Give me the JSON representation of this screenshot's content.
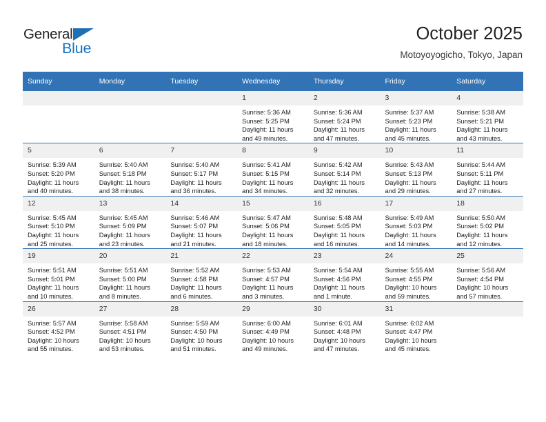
{
  "brand": {
    "name_part1": "General",
    "name_part2": "Blue",
    "accent_color": "#1473c6",
    "triangle_color": "#1f6fb5"
  },
  "header": {
    "title": "October 2025",
    "subtitle": "Motoyoyogicho, Tokyo, Japan"
  },
  "theme": {
    "header_bar": "#3273b5",
    "daynum_bg": "#f0f0f0",
    "week_divider": "#3273b5"
  },
  "weekday_headers": [
    "Sunday",
    "Monday",
    "Tuesday",
    "Wednesday",
    "Thursday",
    "Friday",
    "Saturday"
  ],
  "weeks": [
    [
      {
        "day": "",
        "blank": true,
        "sunrise": "",
        "sunset": "",
        "daylight1": "",
        "daylight2": ""
      },
      {
        "day": "",
        "blank": true,
        "sunrise": "",
        "sunset": "",
        "daylight1": "",
        "daylight2": ""
      },
      {
        "day": "",
        "blank": true,
        "sunrise": "",
        "sunset": "",
        "daylight1": "",
        "daylight2": ""
      },
      {
        "day": "1",
        "sunrise": "Sunrise: 5:36 AM",
        "sunset": "Sunset: 5:25 PM",
        "daylight1": "Daylight: 11 hours",
        "daylight2": "and 49 minutes."
      },
      {
        "day": "2",
        "sunrise": "Sunrise: 5:36 AM",
        "sunset": "Sunset: 5:24 PM",
        "daylight1": "Daylight: 11 hours",
        "daylight2": "and 47 minutes."
      },
      {
        "day": "3",
        "sunrise": "Sunrise: 5:37 AM",
        "sunset": "Sunset: 5:23 PM",
        "daylight1": "Daylight: 11 hours",
        "daylight2": "and 45 minutes."
      },
      {
        "day": "4",
        "sunrise": "Sunrise: 5:38 AM",
        "sunset": "Sunset: 5:21 PM",
        "daylight1": "Daylight: 11 hours",
        "daylight2": "and 43 minutes."
      }
    ],
    [
      {
        "day": "5",
        "sunrise": "Sunrise: 5:39 AM",
        "sunset": "Sunset: 5:20 PM",
        "daylight1": "Daylight: 11 hours",
        "daylight2": "and 40 minutes."
      },
      {
        "day": "6",
        "sunrise": "Sunrise: 5:40 AM",
        "sunset": "Sunset: 5:18 PM",
        "daylight1": "Daylight: 11 hours",
        "daylight2": "and 38 minutes."
      },
      {
        "day": "7",
        "sunrise": "Sunrise: 5:40 AM",
        "sunset": "Sunset: 5:17 PM",
        "daylight1": "Daylight: 11 hours",
        "daylight2": "and 36 minutes."
      },
      {
        "day": "8",
        "sunrise": "Sunrise: 5:41 AM",
        "sunset": "Sunset: 5:15 PM",
        "daylight1": "Daylight: 11 hours",
        "daylight2": "and 34 minutes."
      },
      {
        "day": "9",
        "sunrise": "Sunrise: 5:42 AM",
        "sunset": "Sunset: 5:14 PM",
        "daylight1": "Daylight: 11 hours",
        "daylight2": "and 32 minutes."
      },
      {
        "day": "10",
        "sunrise": "Sunrise: 5:43 AM",
        "sunset": "Sunset: 5:13 PM",
        "daylight1": "Daylight: 11 hours",
        "daylight2": "and 29 minutes."
      },
      {
        "day": "11",
        "sunrise": "Sunrise: 5:44 AM",
        "sunset": "Sunset: 5:11 PM",
        "daylight1": "Daylight: 11 hours",
        "daylight2": "and 27 minutes."
      }
    ],
    [
      {
        "day": "12",
        "sunrise": "Sunrise: 5:45 AM",
        "sunset": "Sunset: 5:10 PM",
        "daylight1": "Daylight: 11 hours",
        "daylight2": "and 25 minutes."
      },
      {
        "day": "13",
        "sunrise": "Sunrise: 5:45 AM",
        "sunset": "Sunset: 5:09 PM",
        "daylight1": "Daylight: 11 hours",
        "daylight2": "and 23 minutes."
      },
      {
        "day": "14",
        "sunrise": "Sunrise: 5:46 AM",
        "sunset": "Sunset: 5:07 PM",
        "daylight1": "Daylight: 11 hours",
        "daylight2": "and 21 minutes."
      },
      {
        "day": "15",
        "sunrise": "Sunrise: 5:47 AM",
        "sunset": "Sunset: 5:06 PM",
        "daylight1": "Daylight: 11 hours",
        "daylight2": "and 18 minutes."
      },
      {
        "day": "16",
        "sunrise": "Sunrise: 5:48 AM",
        "sunset": "Sunset: 5:05 PM",
        "daylight1": "Daylight: 11 hours",
        "daylight2": "and 16 minutes."
      },
      {
        "day": "17",
        "sunrise": "Sunrise: 5:49 AM",
        "sunset": "Sunset: 5:03 PM",
        "daylight1": "Daylight: 11 hours",
        "daylight2": "and 14 minutes."
      },
      {
        "day": "18",
        "sunrise": "Sunrise: 5:50 AM",
        "sunset": "Sunset: 5:02 PM",
        "daylight1": "Daylight: 11 hours",
        "daylight2": "and 12 minutes."
      }
    ],
    [
      {
        "day": "19",
        "sunrise": "Sunrise: 5:51 AM",
        "sunset": "Sunset: 5:01 PM",
        "daylight1": "Daylight: 11 hours",
        "daylight2": "and 10 minutes."
      },
      {
        "day": "20",
        "sunrise": "Sunrise: 5:51 AM",
        "sunset": "Sunset: 5:00 PM",
        "daylight1": "Daylight: 11 hours",
        "daylight2": "and 8 minutes."
      },
      {
        "day": "21",
        "sunrise": "Sunrise: 5:52 AM",
        "sunset": "Sunset: 4:58 PM",
        "daylight1": "Daylight: 11 hours",
        "daylight2": "and 6 minutes."
      },
      {
        "day": "22",
        "sunrise": "Sunrise: 5:53 AM",
        "sunset": "Sunset: 4:57 PM",
        "daylight1": "Daylight: 11 hours",
        "daylight2": "and 3 minutes."
      },
      {
        "day": "23",
        "sunrise": "Sunrise: 5:54 AM",
        "sunset": "Sunset: 4:56 PM",
        "daylight1": "Daylight: 11 hours",
        "daylight2": "and 1 minute."
      },
      {
        "day": "24",
        "sunrise": "Sunrise: 5:55 AM",
        "sunset": "Sunset: 4:55 PM",
        "daylight1": "Daylight: 10 hours",
        "daylight2": "and 59 minutes."
      },
      {
        "day": "25",
        "sunrise": "Sunrise: 5:56 AM",
        "sunset": "Sunset: 4:54 PM",
        "daylight1": "Daylight: 10 hours",
        "daylight2": "and 57 minutes."
      }
    ],
    [
      {
        "day": "26",
        "sunrise": "Sunrise: 5:57 AM",
        "sunset": "Sunset: 4:52 PM",
        "daylight1": "Daylight: 10 hours",
        "daylight2": "and 55 minutes."
      },
      {
        "day": "27",
        "sunrise": "Sunrise: 5:58 AM",
        "sunset": "Sunset: 4:51 PM",
        "daylight1": "Daylight: 10 hours",
        "daylight2": "and 53 minutes."
      },
      {
        "day": "28",
        "sunrise": "Sunrise: 5:59 AM",
        "sunset": "Sunset: 4:50 PM",
        "daylight1": "Daylight: 10 hours",
        "daylight2": "and 51 minutes."
      },
      {
        "day": "29",
        "sunrise": "Sunrise: 6:00 AM",
        "sunset": "Sunset: 4:49 PM",
        "daylight1": "Daylight: 10 hours",
        "daylight2": "and 49 minutes."
      },
      {
        "day": "30",
        "sunrise": "Sunrise: 6:01 AM",
        "sunset": "Sunset: 4:48 PM",
        "daylight1": "Daylight: 10 hours",
        "daylight2": "and 47 minutes."
      },
      {
        "day": "31",
        "sunrise": "Sunrise: 6:02 AM",
        "sunset": "Sunset: 4:47 PM",
        "daylight1": "Daylight: 10 hours",
        "daylight2": "and 45 minutes."
      },
      {
        "day": "",
        "blank": true,
        "sunrise": "",
        "sunset": "",
        "daylight1": "",
        "daylight2": ""
      }
    ]
  ]
}
